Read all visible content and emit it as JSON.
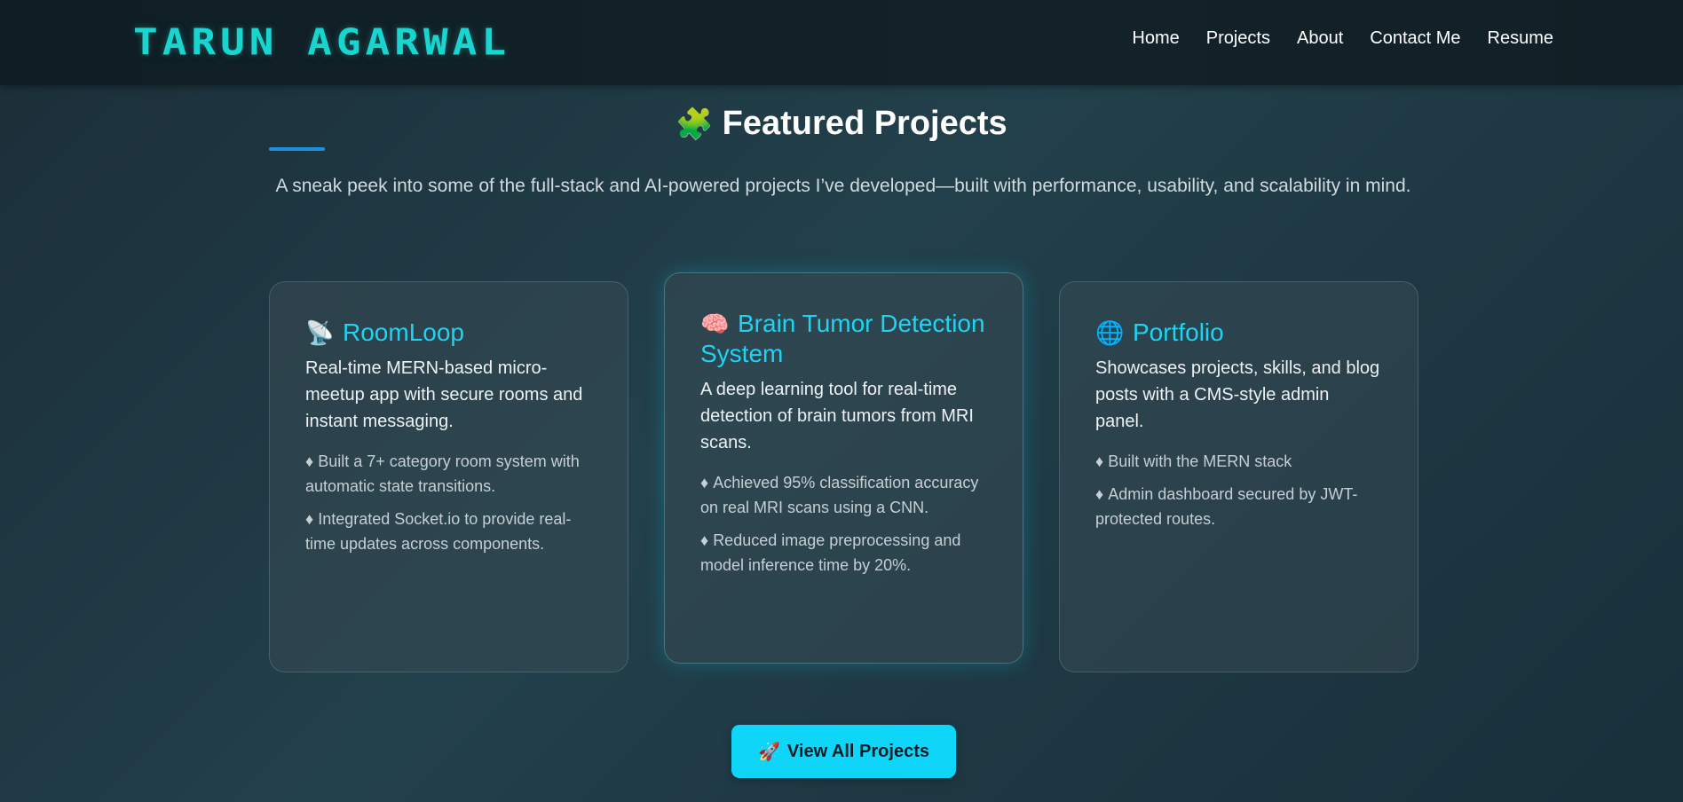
{
  "header": {
    "brand": "TARUN AGARWAL",
    "nav": [
      "Home",
      "Projects",
      "About",
      "Contact Me",
      "Resume"
    ]
  },
  "section": {
    "icon": "puzzle-icon",
    "icon_glyph": "🧩",
    "title": "Featured Projects",
    "subtitle": "A sneak peek into some of the full-stack and AI-powered projects I’ve developed—built with performance, usability, and scalability in mind."
  },
  "projects": [
    {
      "icon": "satellite-dish-icon",
      "icon_glyph": "📡",
      "title": "RoomLoop",
      "description": "Real-time MERN-based micro-meetup app with secure rooms and instant messaging.",
      "points": [
        "Built a 7+ category room system with automatic state transitions.",
        "Integrated Socket.io to provide real-time updates across components."
      ]
    },
    {
      "icon": "brain-icon",
      "icon_glyph": "🧠",
      "title": "Brain Tumor Detection System",
      "description": "A deep learning tool for real-time detection of brain tumors from MRI scans.",
      "points": [
        "Achieved 95% classification accuracy on real MRI scans using a CNN.",
        "Reduced image preprocessing and model inference time by 20%."
      ]
    },
    {
      "icon": "globe-icon",
      "icon_glyph": "🌐",
      "title": "Portfolio",
      "description": "Showcases projects, skills, and blog posts with a CMS-style admin panel.",
      "points": [
        "Built with the MERN stack",
        "Admin dashboard secured by JWT-protected routes."
      ]
    }
  ],
  "bullet_glyph": "♦",
  "cta": {
    "icon": "rocket-icon",
    "icon_glyph": "🚀",
    "label": "View All Projects"
  },
  "colors": {
    "brand": "#18d6cf",
    "accent": "#1fd3f2",
    "button": "#0fd6f8",
    "underline": "#1f8fe0"
  }
}
